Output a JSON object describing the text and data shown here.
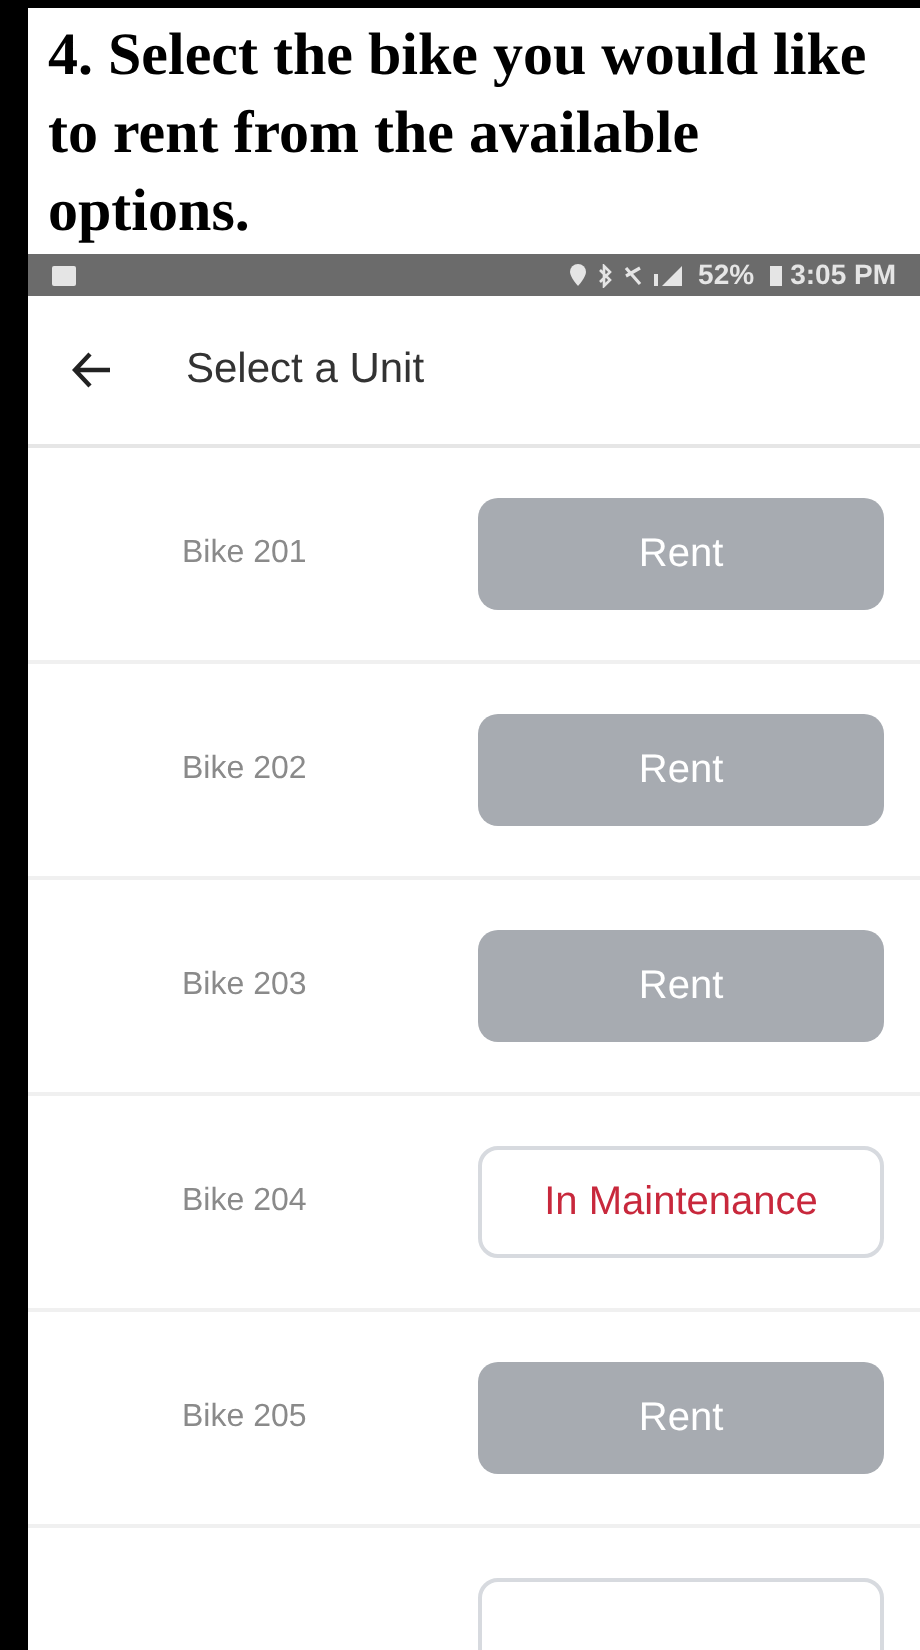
{
  "instruction": "4. Select the bike you would like to rent  from the available options.",
  "status_bar": {
    "battery": "52%",
    "time": "3:05 PM"
  },
  "app_bar": {
    "title": "Select a Unit"
  },
  "units": [
    {
      "name": "Bike 201",
      "kind": "rent",
      "button": "Rent"
    },
    {
      "name": "Bike 202",
      "kind": "rent",
      "button": "Rent"
    },
    {
      "name": "Bike 203",
      "kind": "rent",
      "button": "Rent"
    },
    {
      "name": "Bike 204",
      "kind": "maintenance",
      "button": "In Maintenance"
    },
    {
      "name": "Bike 205",
      "kind": "rent",
      "button": "Rent"
    },
    {
      "kind": "maintenance"
    }
  ]
}
